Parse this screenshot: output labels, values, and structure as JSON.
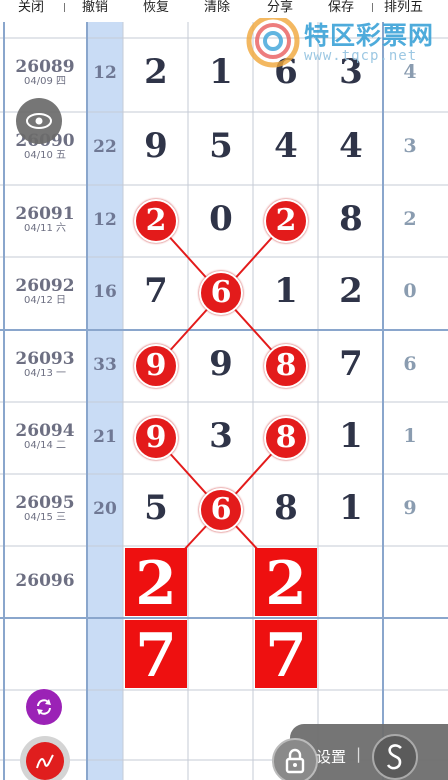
{
  "toolbar": {
    "close": "关闭",
    "undo": "撤销",
    "restore": "恢复",
    "clear": "清除",
    "share": "分享",
    "save": "保存",
    "permutation": "排列五"
  },
  "watermark": {
    "name": "特区彩票网",
    "url": "www.tqcp.net"
  },
  "rows": [
    {
      "period": "26089",
      "date": "04/09 四",
      "sum": "12",
      "digits": [
        "2",
        "1",
        "6",
        "3"
      ],
      "last": "4"
    },
    {
      "period": "26090",
      "date": "04/10 五",
      "sum": "22",
      "digits": [
        "9",
        "5",
        "4",
        "4"
      ],
      "last": "3"
    },
    {
      "period": "26091",
      "date": "04/11 六",
      "sum": "12",
      "digits": [
        "2",
        "0",
        "2",
        "8"
      ],
      "last": "2"
    },
    {
      "period": "26092",
      "date": "04/12 日",
      "sum": "16",
      "digits": [
        "7",
        "6",
        "1",
        "2"
      ],
      "last": "0"
    },
    {
      "period": "26093",
      "date": "04/13 一",
      "sum": "33",
      "digits": [
        "9",
        "9",
        "8",
        "7"
      ],
      "last": "6"
    },
    {
      "period": "26094",
      "date": "04/14 二",
      "sum": "21",
      "digits": [
        "9",
        "3",
        "8",
        "1"
      ],
      "last": "1"
    },
    {
      "period": "26095",
      "date": "04/15 三",
      "sum": "20",
      "digits": [
        "5",
        "6",
        "8",
        "1"
      ],
      "last": "9"
    },
    {
      "period": "26096",
      "date": "",
      "sum": "",
      "digits": [
        "2",
        "",
        "2",
        ""
      ],
      "last": ""
    }
  ],
  "predictions": [
    "7",
    "7"
  ],
  "bottom": {
    "settings": "设置",
    "sep": "|"
  },
  "colors": {
    "ball": "#e31b1b",
    "box": "#ee1010",
    "sumColumn": "#c9dcf5"
  },
  "icons": [
    "eye-icon",
    "refresh-icon",
    "pen-icon",
    "lock-icon",
    "s-logo-icon"
  ]
}
